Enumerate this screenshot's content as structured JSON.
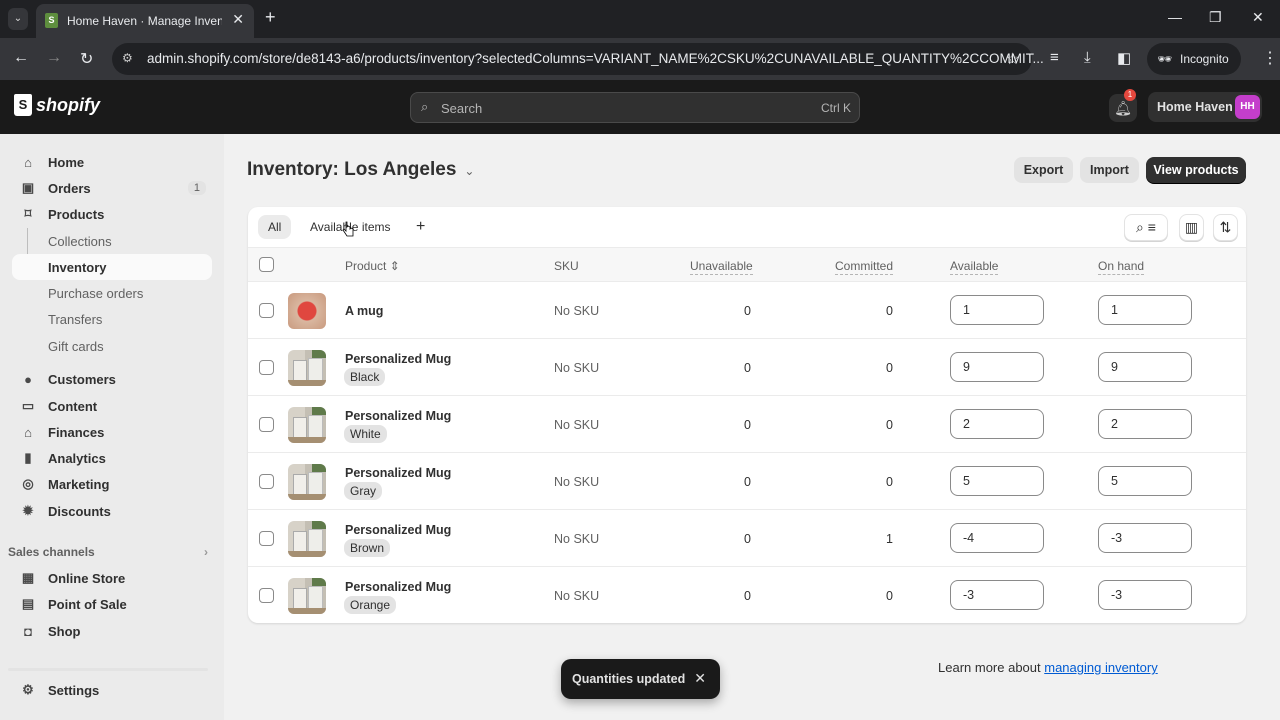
{
  "browser": {
    "tab_title": "Home Haven · Manage Inventory",
    "url": "admin.shopify.com/store/de8143-a6/products/inventory?selectedColumns=VARIANT_NAME%2CSKU%2CUNAVAILABLE_QUANTITY%2CCOMMIT...",
    "profile_label": "Incognito"
  },
  "topbar": {
    "logo_text": "shopify",
    "search_placeholder": "Search",
    "search_shortcut": "Ctrl K",
    "notification_count": "1",
    "store_name": "Home Haven",
    "avatar_initials": "HH",
    "avatar_color": "#c43ecb"
  },
  "sidebar": {
    "items": [
      {
        "label": "Home",
        "icon": "home-icon"
      },
      {
        "label": "Orders",
        "icon": "inbox-icon",
        "count": "1"
      },
      {
        "label": "Products",
        "icon": "tag-icon"
      },
      {
        "label": "Collections",
        "sub": true
      },
      {
        "label": "Inventory",
        "sub": true,
        "active": true
      },
      {
        "label": "Purchase orders",
        "sub": true
      },
      {
        "label": "Transfers",
        "sub": true
      },
      {
        "label": "Gift cards",
        "sub": true
      },
      {
        "label": "Customers",
        "icon": "person-icon"
      },
      {
        "label": "Content",
        "icon": "content-icon"
      },
      {
        "label": "Finances",
        "icon": "bank-icon"
      },
      {
        "label": "Analytics",
        "icon": "bar-chart-icon"
      },
      {
        "label": "Marketing",
        "icon": "target-icon"
      },
      {
        "label": "Discounts",
        "icon": "discount-icon"
      }
    ],
    "sales_channels_label": "Sales channels",
    "channels": [
      {
        "label": "Online Store",
        "icon": "store-icon"
      },
      {
        "label": "Point of Sale",
        "icon": "pos-icon"
      },
      {
        "label": "Shop",
        "icon": "shop-icon"
      }
    ],
    "settings_label": "Settings"
  },
  "page": {
    "title": "Inventory: Los Angeles",
    "export_label": "Export",
    "import_label": "Import",
    "view_products_label": "View products",
    "filter_tabs": [
      "All",
      "Available items"
    ],
    "add_view_label": "+",
    "columns": [
      "Product",
      "SKU",
      "Unavailable",
      "Committed",
      "Available",
      "On hand"
    ],
    "rows": [
      {
        "product": "A mug",
        "variant": "",
        "sku": "No SKU",
        "unavailable": "0",
        "committed": "0",
        "available": "1",
        "on_hand": "1",
        "thumb": "red"
      },
      {
        "product": "Personalized Mug",
        "variant": "Black",
        "sku": "No SKU",
        "unavailable": "0",
        "committed": "0",
        "available": "9",
        "on_hand": "9",
        "thumb": "mug"
      },
      {
        "product": "Personalized Mug",
        "variant": "White",
        "sku": "No SKU",
        "unavailable": "0",
        "committed": "0",
        "available": "2",
        "on_hand": "2",
        "thumb": "mug"
      },
      {
        "product": "Personalized Mug",
        "variant": "Gray",
        "sku": "No SKU",
        "unavailable": "0",
        "committed": "0",
        "available": "5",
        "on_hand": "5",
        "thumb": "mug"
      },
      {
        "product": "Personalized Mug",
        "variant": "Brown",
        "sku": "No SKU",
        "unavailable": "0",
        "committed": "1",
        "available": "-4",
        "on_hand": "-3",
        "thumb": "mug"
      },
      {
        "product": "Personalized Mug",
        "variant": "Orange",
        "sku": "No SKU",
        "unavailable": "0",
        "committed": "0",
        "available": "-3",
        "on_hand": "-3",
        "thumb": "mug"
      }
    ],
    "footer_text": "Learn more about",
    "footer_link": "managing inventory"
  },
  "toast": {
    "message": "Quantities updated"
  }
}
